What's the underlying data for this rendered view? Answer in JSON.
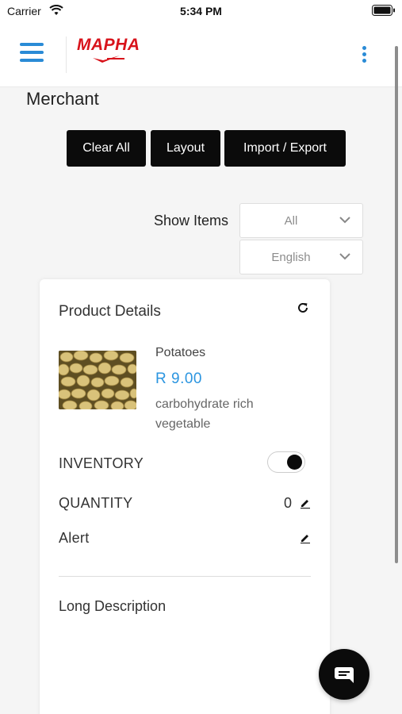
{
  "status_bar": {
    "carrier": "Carrier",
    "time": "5:34 PM"
  },
  "header": {
    "logo_text": "MAPHA",
    "icons": [
      "menu-icon",
      "more-vertical-icon"
    ]
  },
  "page": {
    "title": "Merchant"
  },
  "toolbar": {
    "clear_all": "Clear All",
    "layout": "Layout",
    "import_export": "Import / Export"
  },
  "filters": {
    "show_items_label": "Show Items",
    "items_select": {
      "value": "All"
    },
    "language_select": {
      "value": "English"
    }
  },
  "product_card": {
    "title": "Product Details",
    "product": {
      "name": "Potatoes",
      "price": "R 9.00",
      "description": "carbohydrate rich vegetable"
    },
    "inventory_label": "INVENTORY",
    "inventory_enabled": true,
    "quantity_label": "QUANTITY",
    "quantity_value": "0",
    "alert_label": "Alert",
    "long_description_label": "Long Description"
  },
  "colors": {
    "accent": "#2a8bd6",
    "price": "#2b95e0",
    "brand_red": "#d8131b",
    "button": "#0b0b0b"
  }
}
